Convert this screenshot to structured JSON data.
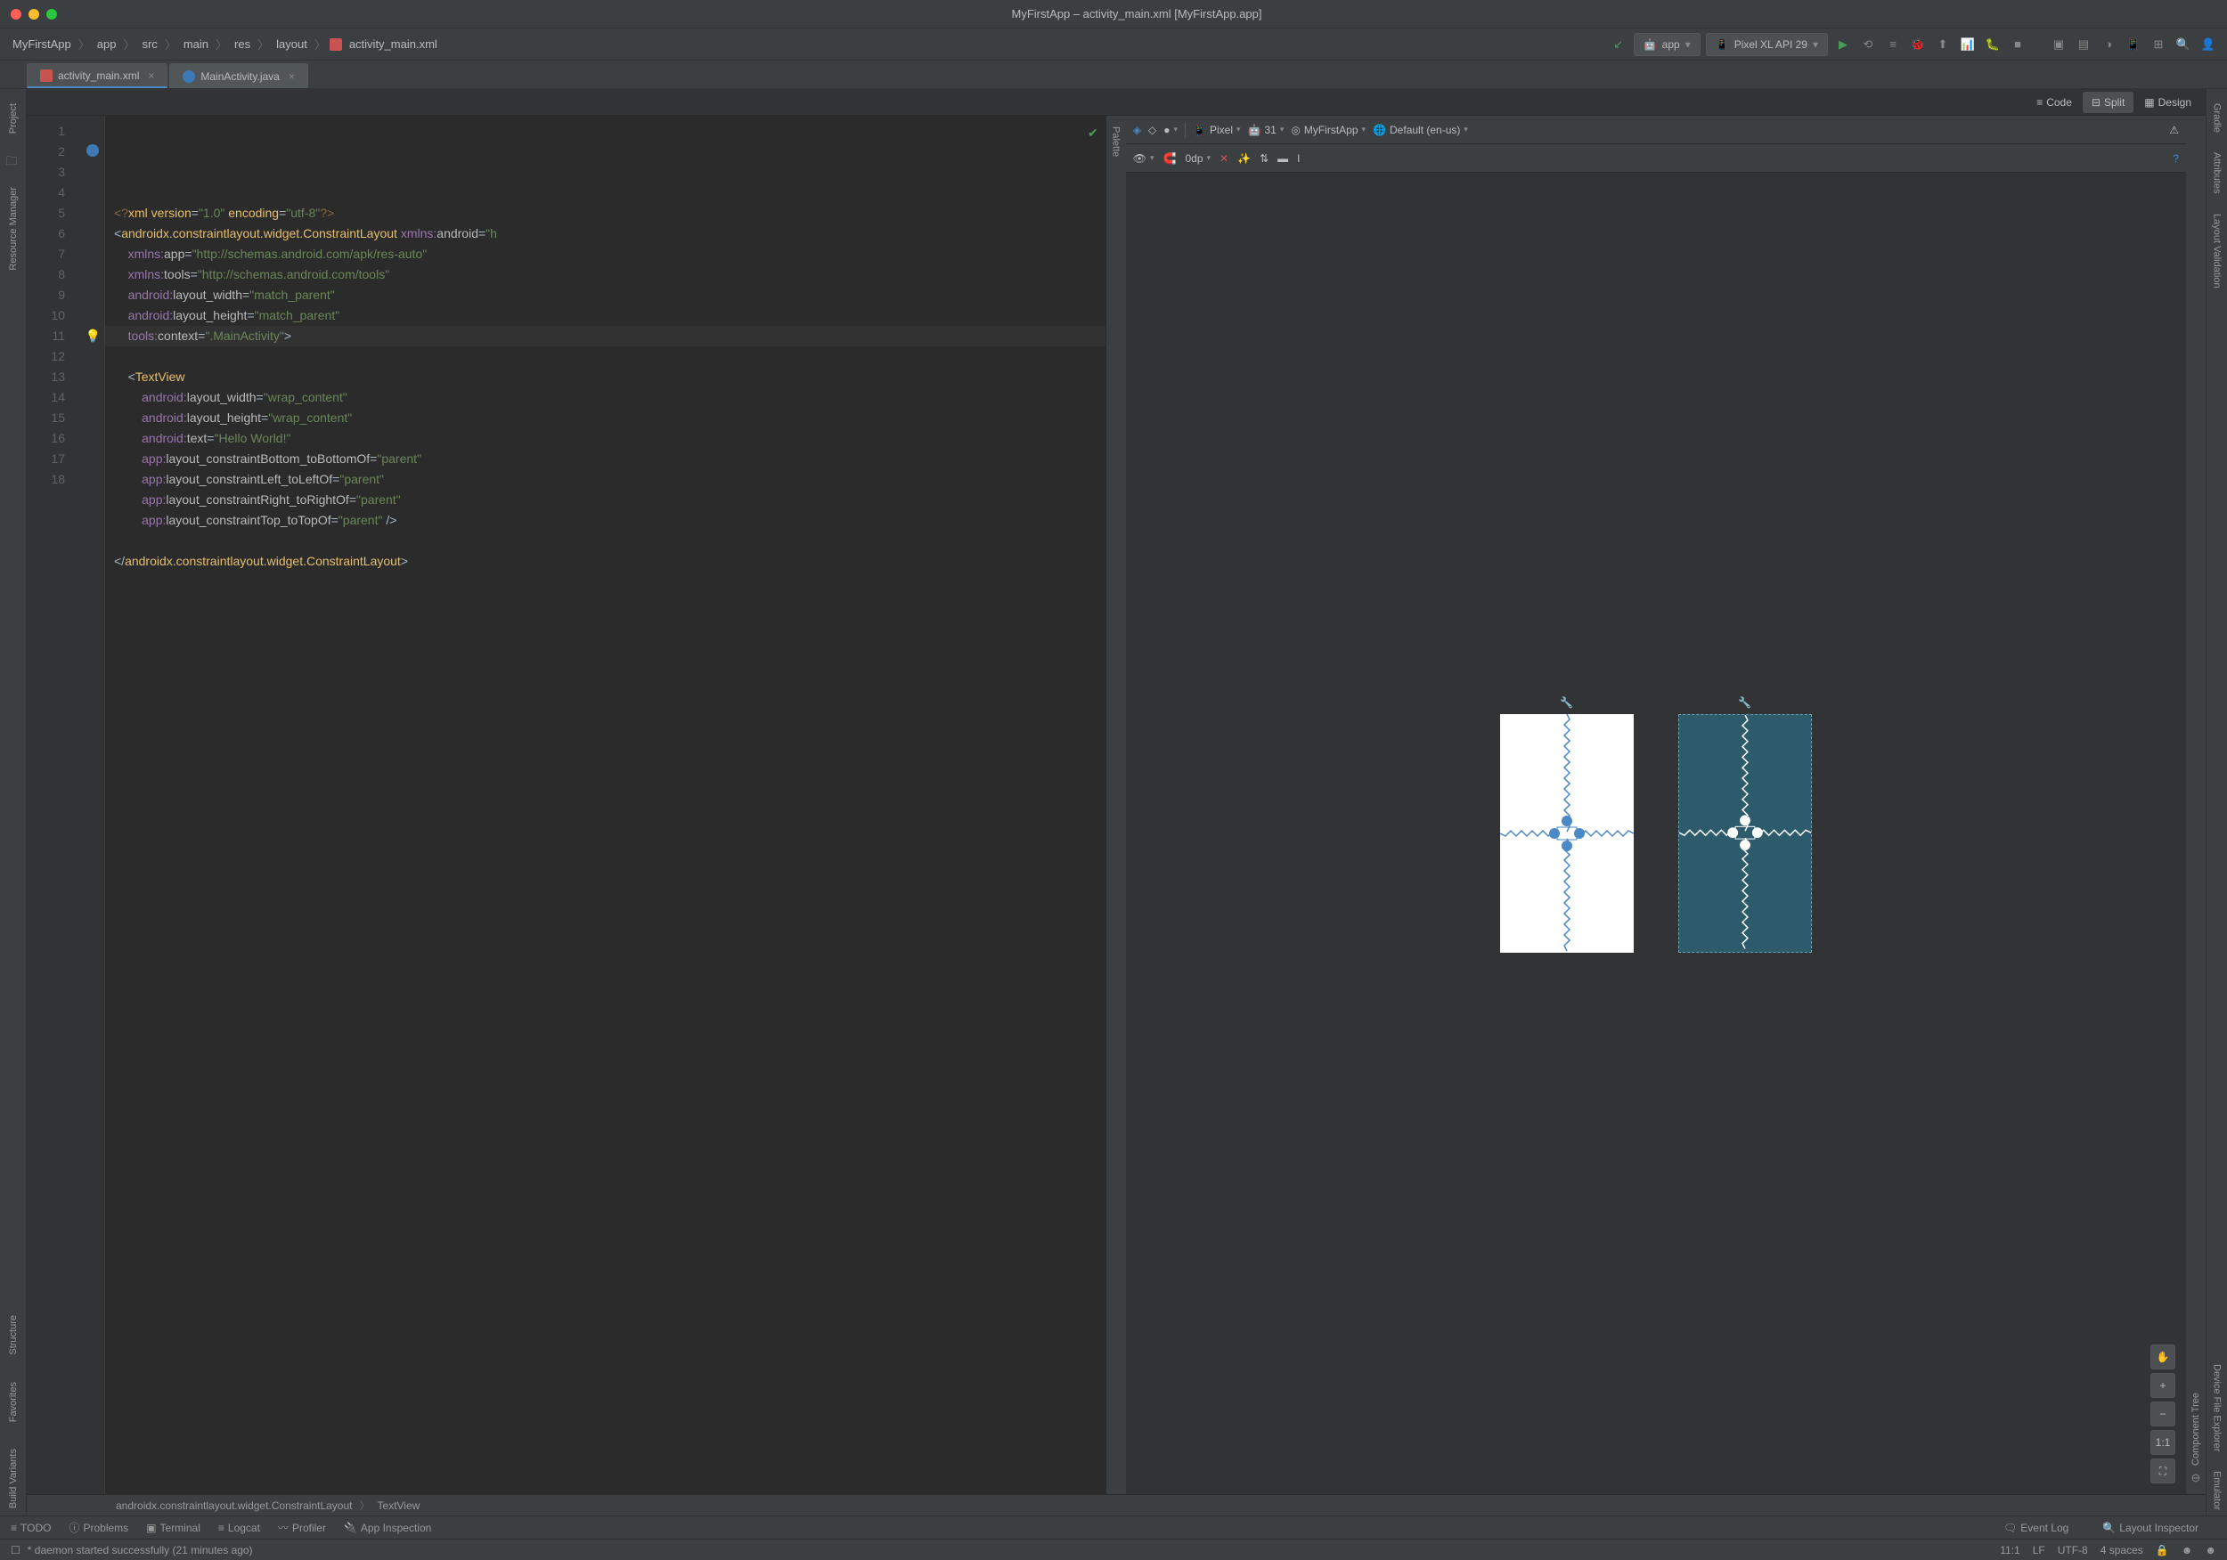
{
  "window": {
    "title": "MyFirstApp – activity_main.xml [MyFirstApp.app]"
  },
  "breadcrumbs": [
    "MyFirstApp",
    "app",
    "src",
    "main",
    "res",
    "layout",
    "activity_main.xml"
  ],
  "run_config": {
    "app": "app",
    "device": "Pixel XL API 29"
  },
  "tabs": [
    {
      "name": "activity_main.xml",
      "type": "xml",
      "active": true
    },
    {
      "name": "MainActivity.java",
      "type": "java",
      "active": false
    }
  ],
  "view_modes": {
    "code": "Code",
    "split": "Split",
    "design": "Design",
    "active": "split"
  },
  "left_sidebar": [
    "Project",
    "Resource Manager",
    "Structure",
    "Favorites",
    "Build Variants"
  ],
  "right_sidebar": [
    "Gradle",
    "Attributes",
    "Layout Validation",
    "Device File Explorer",
    "Emulator"
  ],
  "design_toolbar": {
    "device": "Pixel",
    "api": "31",
    "theme": "MyFirstApp",
    "locale": "Default (en-us)",
    "margin": "0dp"
  },
  "design_panels": {
    "palette": "Palette",
    "component_tree": "Component Tree"
  },
  "zoom_11": "1:1",
  "bottom_crumb": [
    "androidx.constraintlayout.widget.ConstraintLayout",
    "TextView"
  ],
  "bottom_tools": [
    "TODO",
    "Problems",
    "Terminal",
    "Logcat",
    "Profiler",
    "App Inspection"
  ],
  "bottom_right": [
    "Event Log",
    "Layout Inspector"
  ],
  "status_msg": "* daemon started successfully (21 minutes ago)",
  "status_right": {
    "pos": "11:1",
    "lf": "LF",
    "enc": "UTF-8",
    "indent": "4 spaces"
  },
  "code": {
    "lines": 18,
    "highlighted_line": 11
  },
  "xml": {
    "pi": "<?xml version=\"1.0\" encoding=\"utf-8\"?>",
    "root_tag": "androidx.constraintlayout.widget.ConstraintLayout",
    "xmlns_android": "http://schemas.android.com/apk/res/android",
    "xmlns_app": "http://schemas.android.com/apk/res-auto",
    "xmlns_tools": "http://schemas.android.com/tools",
    "layout_width": "match_parent",
    "layout_height": "match_parent",
    "tools_context": ".MainActivity",
    "textview": {
      "layout_width": "wrap_content",
      "layout_height": "wrap_content",
      "text": "Hello World!",
      "constraintBottom": "parent",
      "constraintLeft": "parent",
      "constraintRight": "parent",
      "constraintTop": "parent"
    }
  }
}
